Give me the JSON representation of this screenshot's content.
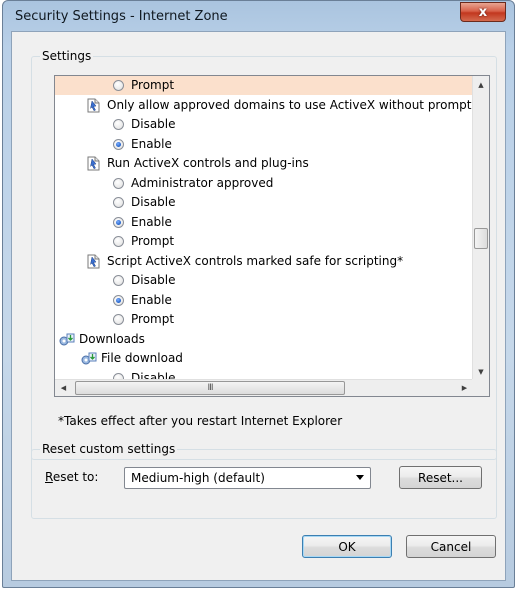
{
  "window": {
    "title": "Security Settings - Internet Zone",
    "close_glyph": "x"
  },
  "settings": {
    "group_label": "Settings",
    "rows": [
      {
        "kind": "radio",
        "label": "Prompt",
        "checked": false,
        "highlight": true
      },
      {
        "kind": "setting",
        "label": "Only allow approved domains to use ActiveX without prompt"
      },
      {
        "kind": "radio",
        "label": "Disable",
        "checked": false
      },
      {
        "kind": "radio",
        "label": "Enable",
        "checked": true
      },
      {
        "kind": "setting",
        "label": "Run ActiveX controls and plug-ins"
      },
      {
        "kind": "radio",
        "label": "Administrator approved",
        "checked": false
      },
      {
        "kind": "radio",
        "label": "Disable",
        "checked": false
      },
      {
        "kind": "radio",
        "label": "Enable",
        "checked": true
      },
      {
        "kind": "radio",
        "label": "Prompt",
        "checked": false
      },
      {
        "kind": "setting",
        "label": "Script ActiveX controls marked safe for scripting*"
      },
      {
        "kind": "radio",
        "label": "Disable",
        "checked": false
      },
      {
        "kind": "radio",
        "label": "Enable",
        "checked": true
      },
      {
        "kind": "radio",
        "label": "Prompt",
        "checked": false
      },
      {
        "kind": "category",
        "label": "Downloads"
      },
      {
        "kind": "subcategory",
        "label": "File download"
      },
      {
        "kind": "radio",
        "label": "Disable",
        "checked": false
      }
    ],
    "hscroll_grip": "III",
    "note": "*Takes effect after you restart Internet Explorer"
  },
  "reset": {
    "group_label": "Reset custom settings",
    "reset_to_label": "Reset to:",
    "selected": "Medium-high (default)",
    "reset_button": "Reset..."
  },
  "buttons": {
    "ok": "OK",
    "cancel": "Cancel"
  },
  "colors": {
    "highlight_row": "#fbe0cc",
    "radio_checked": "#1f5fc8",
    "close_button": "#c2371f"
  }
}
